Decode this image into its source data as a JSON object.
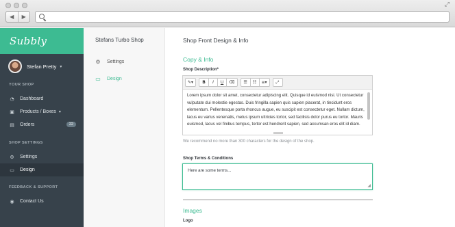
{
  "browser": {
    "url": "",
    "back_glyph": "◀",
    "forward_glyph": "▶",
    "resize_glyph": "⤢"
  },
  "sidebar": {
    "brand": "Subbly",
    "user": {
      "name": "Stefan Pretty",
      "caret": "▾"
    },
    "sections": {
      "your_shop": "YOUR SHOP",
      "shop_settings": "SHOP SETTINGS",
      "feedback": "FEEDBACK & SUPPORT"
    },
    "items": [
      {
        "label": "Dashboard",
        "icon": "dashboard-icon",
        "glyph": "◔"
      },
      {
        "label": "Products / Boxes",
        "icon": "box-icon",
        "glyph": "▣",
        "caret": "▾"
      },
      {
        "label": "Orders",
        "icon": "orders-icon",
        "glyph": "▤",
        "badge": "22"
      },
      {
        "label": "Settings",
        "icon": "gear-icon",
        "glyph": "⚙"
      },
      {
        "label": "Design",
        "icon": "monitor-icon",
        "glyph": "▭"
      },
      {
        "label": "Contact Us",
        "icon": "contact-icon",
        "glyph": "◉"
      }
    ]
  },
  "subnav": {
    "shop_name": "Stefans Turbo Shop",
    "items": [
      {
        "label": "Settings",
        "icon": "gear-icon",
        "glyph": "⚙"
      },
      {
        "label": "Design",
        "icon": "monitor-icon",
        "glyph": "▭"
      }
    ]
  },
  "main": {
    "title": "Shop Front Design & Info",
    "copy_heading": "Copy & Info",
    "description_label": "Shop Description*",
    "toolbar": {
      "magic": "✎▾",
      "bold": "B",
      "italic": "I",
      "underline": "U",
      "eraser": "⌫",
      "ul": "☰",
      "ol": "☷",
      "align": "≡▾",
      "fullscreen": "⤢"
    },
    "description_text": "Lorem ipsum dolor sit amet, consectetur adipiscing elit. Quisque id euismod nisi. Ut consectetur vulputate dui molestie egestas. Duis fringilla sapien quis sapien placerat, in tincidunt eros elementum. Pellentesque porta rhoncus augue, eu suscipit est consectetur eget. Nullam dictum, lacus eu varius venenatis, metus ipsum ultricies tortor, sed facilisis dolor purus eu tortor. Mauris euismod, lacus vel finibus tempus, tortor est hendrerit sapien, sed accumsan eros elit id diam.",
    "hint": "We recommend no more than 300 characters for the design of the shop.",
    "terms_label": "Shop Terms & Conditions",
    "terms_value": "Here are some terms...",
    "images_heading": "Images",
    "logo_label": "Logo"
  },
  "colors": {
    "accent": "#3dbb92",
    "sidebar_bg": "#37424b",
    "sidebar_active": "#2d363e"
  }
}
